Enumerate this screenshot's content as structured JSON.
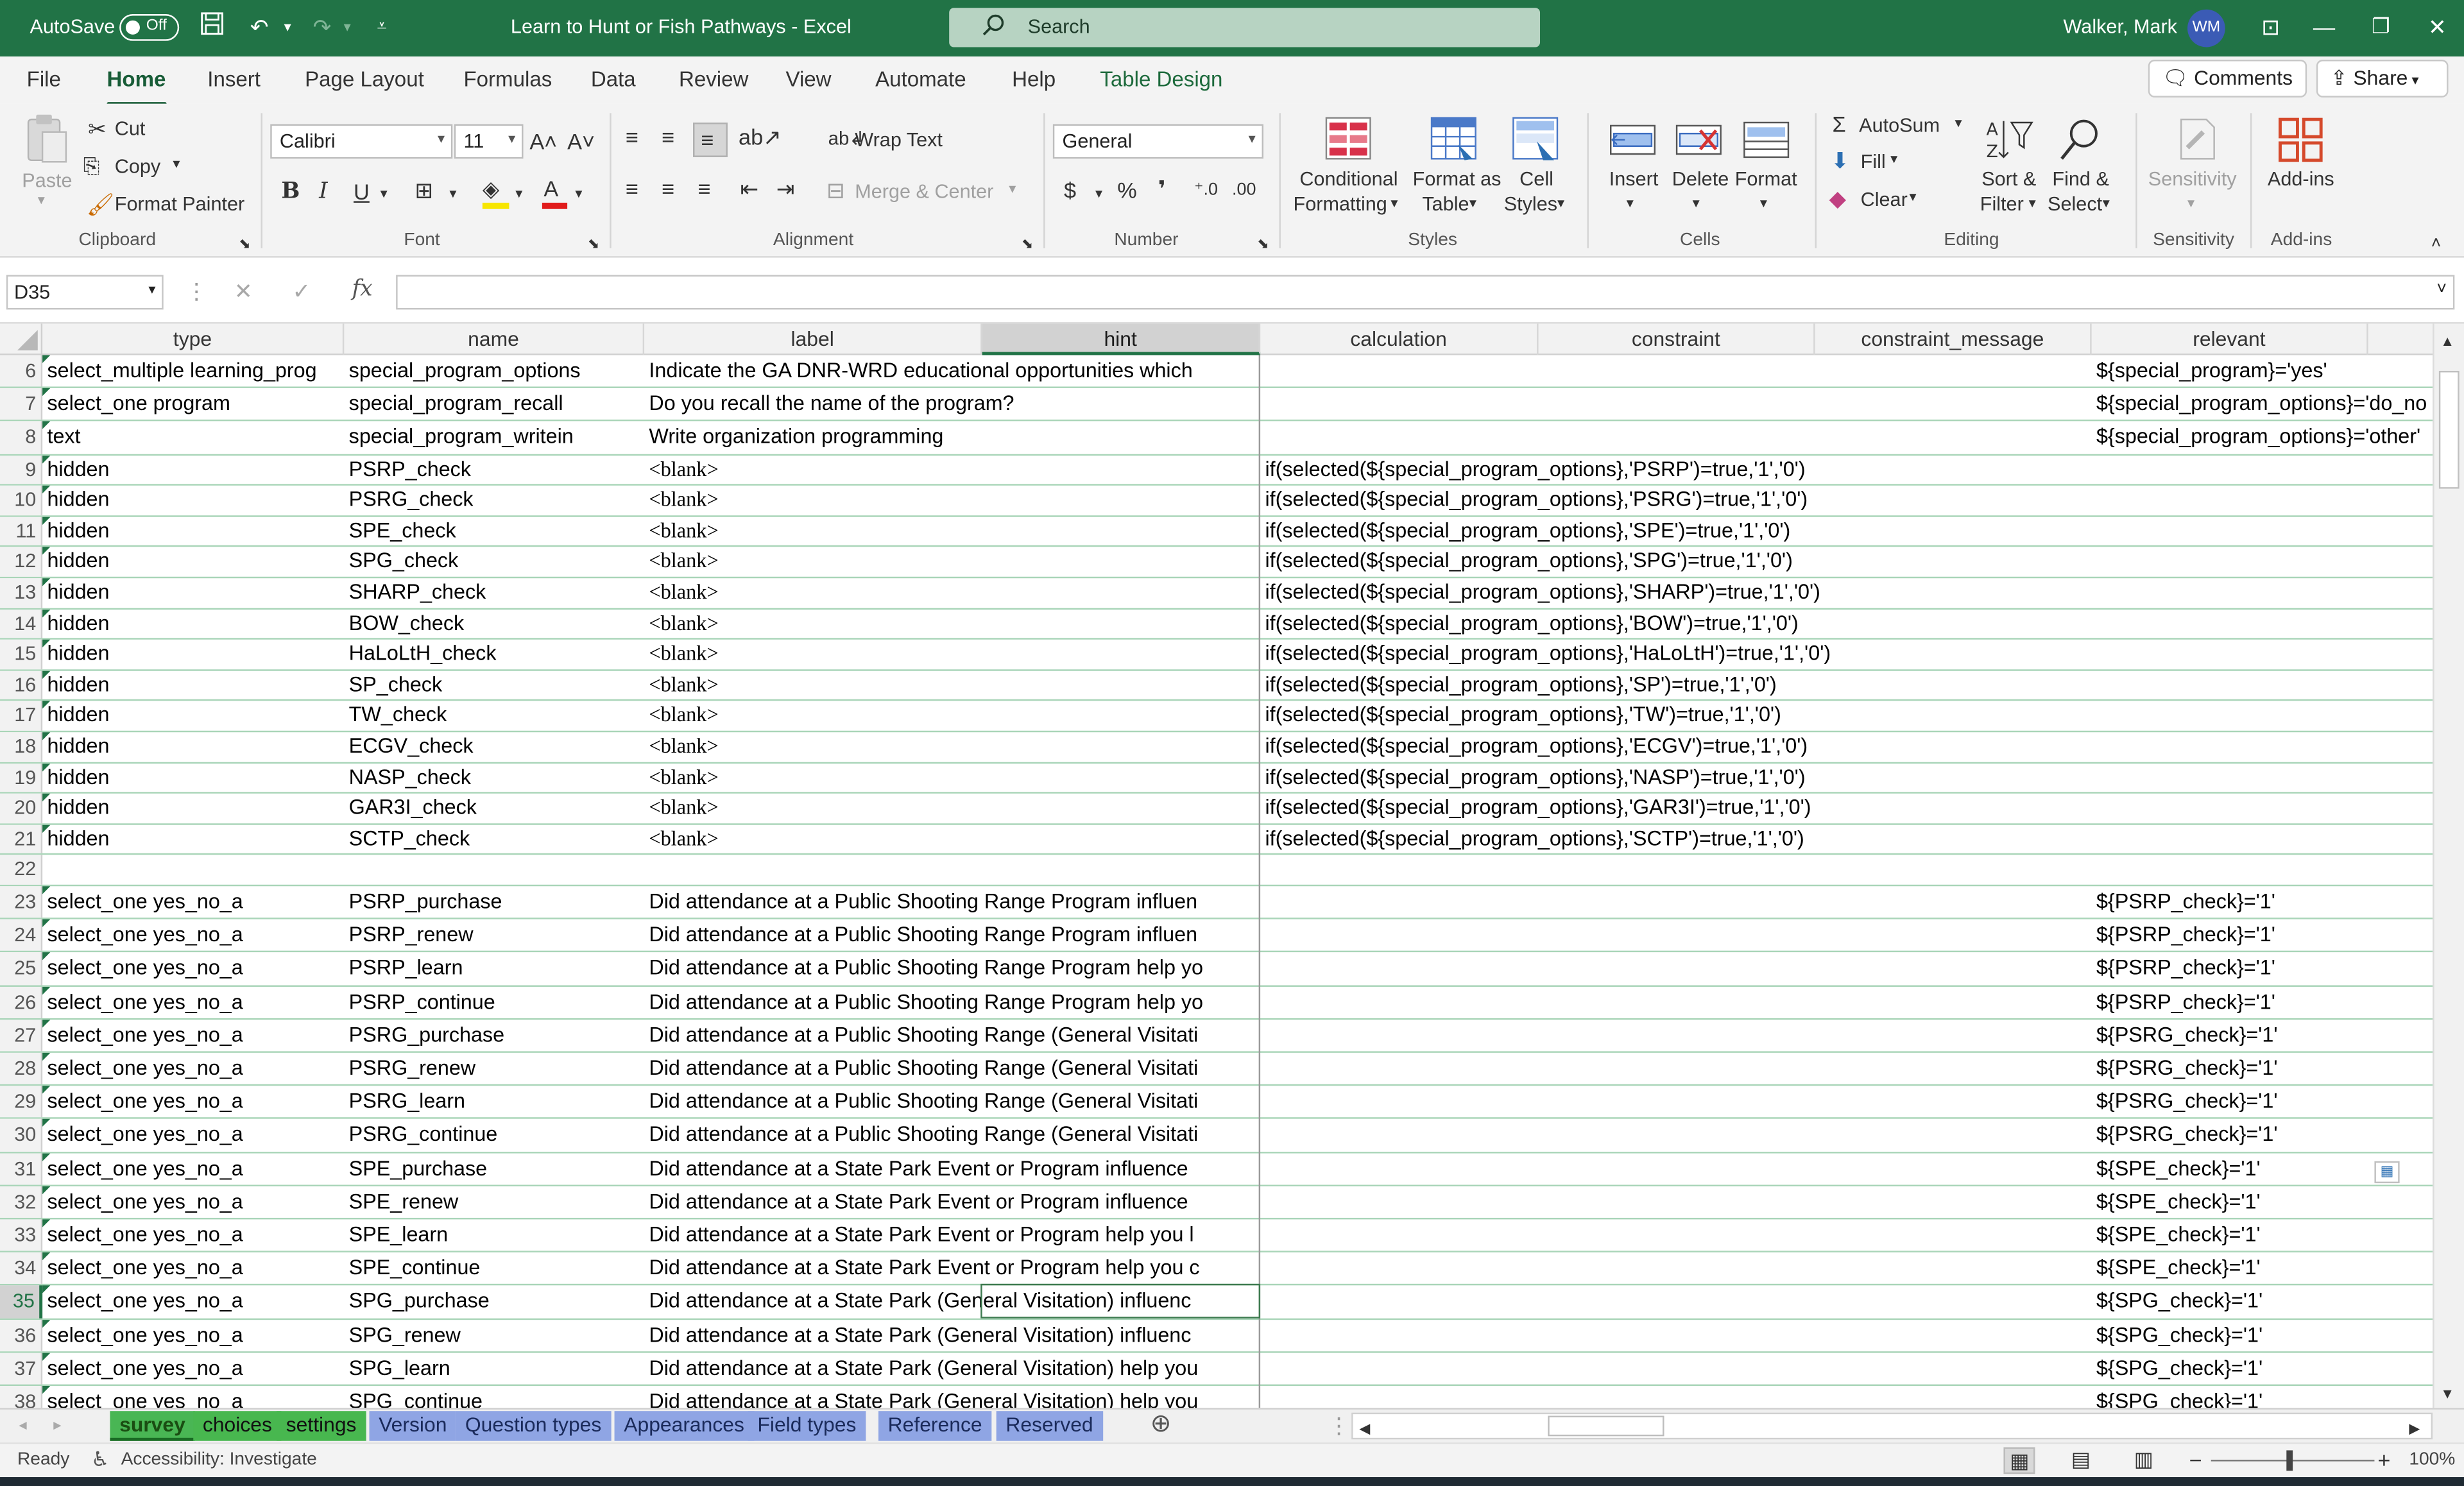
{
  "titlebar": {
    "autosave_label": "AutoSave",
    "autosave_state": "Off",
    "doc_title": "Learn to Hunt or Fish Pathways  -  Excel",
    "search_placeholder": "Search",
    "user_name": "Walker, Mark",
    "user_initials": "WM",
    "brand_color": "#217346"
  },
  "menu": {
    "tabs": [
      "File",
      "Home",
      "Insert",
      "Page Layout",
      "Formulas",
      "Data",
      "Review",
      "View",
      "Automate",
      "Help",
      "Table Design"
    ],
    "active_tab": "Home",
    "comments_label": "Comments",
    "share_label": "Share"
  },
  "ribbon": {
    "clipboard": {
      "paste": "Paste",
      "cut": "Cut",
      "copy": "Copy",
      "format_painter": "Format Painter",
      "label": "Clipboard"
    },
    "font": {
      "name": "Calibri",
      "size": "11",
      "label": "Font"
    },
    "alignment": {
      "wrap_text": "Wrap Text",
      "merge_center": "Merge & Center",
      "label": "Alignment"
    },
    "number": {
      "format": "General",
      "label": "Number"
    },
    "styles": {
      "conditional_1": "Conditional",
      "conditional_2": "Formatting",
      "format_table_1": "Format as",
      "format_table_2": "Table",
      "cell_styles_1": "Cell",
      "cell_styles_2": "Styles",
      "label": "Styles"
    },
    "cells": {
      "insert": "Insert",
      "delete": "Delete",
      "format": "Format",
      "label": "Cells"
    },
    "editing": {
      "autosum": "AutoSum",
      "fill": "Fill",
      "clear": "Clear",
      "sort_1": "Sort &",
      "sort_2": "Filter",
      "find_1": "Find &",
      "find_2": "Select",
      "label": "Editing"
    },
    "sensitivity": {
      "button": "Sensitivity",
      "label": "Sensitivity"
    },
    "addins": {
      "button": "Add-ins",
      "label": "Add-ins"
    }
  },
  "formula_bar": {
    "name_box": "D35",
    "fx": "fx",
    "content": ""
  },
  "columns": [
    "type",
    "name",
    "label",
    "hint",
    "calculation",
    "constraint",
    "constraint_message",
    "relevant"
  ],
  "selected_column": "hint",
  "rows": [
    {
      "n": "6",
      "type": "select_multiple learning_prog",
      "name": "special_program_options",
      "label": "Indicate the GA DNR-WRD educational opportunities which",
      "calculation": "",
      "relevant": "${special_program}='yes'"
    },
    {
      "n": "7",
      "type": "select_one program",
      "name": "special_program_recall",
      "label": "Do you recall the name of the program?",
      "calculation": "",
      "relevant": "${special_program_options}='do_no"
    },
    {
      "n": "8",
      "type": "text",
      "name": "special_program_writein",
      "label": "Write organization programming",
      "calculation": "",
      "relevant": "${special_program_options}='other'"
    },
    {
      "n": "9",
      "type": "hidden",
      "name": "PSRP_check",
      "label": "<blank>",
      "calculation": "if(selected(${special_program_options},'PSRP')=true,'1','0')",
      "relevant": ""
    },
    {
      "n": "10",
      "type": "hidden",
      "name": "PSRG_check",
      "label": "<blank>",
      "calculation": "if(selected(${special_program_options},'PSRG')=true,'1','0')",
      "relevant": ""
    },
    {
      "n": "11",
      "type": "hidden",
      "name": "SPE_check",
      "label": "<blank>",
      "calculation": "if(selected(${special_program_options},'SPE')=true,'1','0')",
      "relevant": ""
    },
    {
      "n": "12",
      "type": "hidden",
      "name": "SPG_check",
      "label": "<blank>",
      "calculation": "if(selected(${special_program_options},'SPG')=true,'1','0')",
      "relevant": ""
    },
    {
      "n": "13",
      "type": "hidden",
      "name": "SHARP_check",
      "label": "<blank>",
      "calculation": "if(selected(${special_program_options},'SHARP')=true,'1','0')",
      "relevant": ""
    },
    {
      "n": "14",
      "type": "hidden",
      "name": "BOW_check",
      "label": "<blank>",
      "calculation": "if(selected(${special_program_options},'BOW')=true,'1','0')",
      "relevant": ""
    },
    {
      "n": "15",
      "type": "hidden",
      "name": "HaLoLtH_check",
      "label": "<blank>",
      "calculation": "if(selected(${special_program_options},'HaLoLtH')=true,'1','0')",
      "relevant": ""
    },
    {
      "n": "16",
      "type": "hidden",
      "name": "SP_check",
      "label": "<blank>",
      "calculation": "if(selected(${special_program_options},'SP')=true,'1','0')",
      "relevant": ""
    },
    {
      "n": "17",
      "type": "hidden",
      "name": "TW_check",
      "label": "<blank>",
      "calculation": "if(selected(${special_program_options},'TW')=true,'1','0')",
      "relevant": ""
    },
    {
      "n": "18",
      "type": "hidden",
      "name": "ECGV_check",
      "label": "<blank>",
      "calculation": "if(selected(${special_program_options},'ECGV')=true,'1','0')",
      "relevant": ""
    },
    {
      "n": "19",
      "type": "hidden",
      "name": "NASP_check",
      "label": "<blank>",
      "calculation": "if(selected(${special_program_options},'NASP')=true,'1','0')",
      "relevant": ""
    },
    {
      "n": "20",
      "type": "hidden",
      "name": "GAR3I_check",
      "label": "<blank>",
      "calculation": "if(selected(${special_program_options},'GAR3I')=true,'1','0')",
      "relevant": ""
    },
    {
      "n": "21",
      "type": "hidden",
      "name": "SCTP_check",
      "label": "<blank>",
      "calculation": "if(selected(${special_program_options},'SCTP')=true,'1','0')",
      "relevant": ""
    },
    {
      "n": "22",
      "type": "",
      "name": "",
      "label": "",
      "calculation": "",
      "relevant": ""
    },
    {
      "n": "23",
      "type": "select_one yes_no_a",
      "name": "PSRP_purchase",
      "label": "Did attendance at a Public Shooting Range Program influen",
      "calculation": "",
      "relevant": "${PSRP_check}='1'"
    },
    {
      "n": "24",
      "type": "select_one yes_no_a",
      "name": "PSRP_renew",
      "label": "Did attendance at a Public Shooting Range Program influen",
      "calculation": "",
      "relevant": "${PSRP_check}='1'"
    },
    {
      "n": "25",
      "type": "select_one yes_no_a",
      "name": "PSRP_learn",
      "label": "Did attendance at a Public Shooting Range Program help yo",
      "calculation": "",
      "relevant": "${PSRP_check}='1'"
    },
    {
      "n": "26",
      "type": "select_one yes_no_a",
      "name": "PSRP_continue",
      "label": "Did attendance at a Public Shooting Range Program help yo",
      "calculation": "",
      "relevant": "${PSRP_check}='1'"
    },
    {
      "n": "27",
      "type": "select_one yes_no_a",
      "name": "PSRG_purchase",
      "label": "Did attendance at a Public Shooting Range (General Visitati",
      "calculation": "",
      "relevant": "${PSRG_check}='1'"
    },
    {
      "n": "28",
      "type": "select_one yes_no_a",
      "name": "PSRG_renew",
      "label": "Did attendance at a Public Shooting Range (General Visitati",
      "calculation": "",
      "relevant": "${PSRG_check}='1'"
    },
    {
      "n": "29",
      "type": "select_one yes_no_a",
      "name": "PSRG_learn",
      "label": "Did attendance at a Public Shooting Range (General Visitati",
      "calculation": "",
      "relevant": "${PSRG_check}='1'"
    },
    {
      "n": "30",
      "type": "select_one yes_no_a",
      "name": "PSRG_continue",
      "label": "Did attendance at a Public Shooting Range (General Visitati",
      "calculation": "",
      "relevant": "${PSRG_check}='1'"
    },
    {
      "n": "31",
      "type": "select_one yes_no_a",
      "name": "SPE_purchase",
      "label": "Did attendance at a State Park Event or Program influence",
      "calculation": "",
      "relevant": "${SPE_check}='1'"
    },
    {
      "n": "32",
      "type": "select_one yes_no_a",
      "name": "SPE_renew",
      "label": "Did attendance at a State Park Event or Program influence",
      "calculation": "",
      "relevant": "${SPE_check}='1'"
    },
    {
      "n": "33",
      "type": "select_one yes_no_a",
      "name": "SPE_learn",
      "label": "Did attendance at a State Park Event or Program help you l",
      "calculation": "",
      "relevant": "${SPE_check}='1'"
    },
    {
      "n": "34",
      "type": "select_one yes_no_a",
      "name": "SPE_continue",
      "label": "Did attendance at a State Park Event or Program help you c",
      "calculation": "",
      "relevant": "${SPE_check}='1'"
    },
    {
      "n": "35",
      "type": "select_one yes_no_a",
      "name": "SPG_purchase",
      "label": "Did attendance at a State Park (General Visitation) influenc",
      "calculation": "",
      "relevant": "${SPG_check}='1'"
    },
    {
      "n": "36",
      "type": "select_one yes_no_a",
      "name": "SPG_renew",
      "label": "Did attendance at a State Park (General Visitation) influenc",
      "calculation": "",
      "relevant": "${SPG_check}='1'"
    },
    {
      "n": "37",
      "type": "select_one yes_no_a",
      "name": "SPG_learn",
      "label": "Did attendance at a State Park (General Visitation) help you",
      "calculation": "",
      "relevant": "${SPG_check}='1'"
    },
    {
      "n": "38",
      "type": "select_one yes_no_a",
      "name": "SPG_continue",
      "label": "Did attendance at a State Park (General Visitation) help you",
      "calculation": "",
      "relevant": "${SPG_check}='1'"
    }
  ],
  "selected_row": "35",
  "sheet_tabs": [
    {
      "label": "survey",
      "color": "green",
      "active": true
    },
    {
      "label": "choices",
      "color": "green",
      "active": false
    },
    {
      "label": "settings",
      "color": "green",
      "active": false
    },
    {
      "label": "Version",
      "color": "blue",
      "active": false
    },
    {
      "label": "Question types",
      "color": "blue",
      "active": false
    },
    {
      "label": "Appearances",
      "color": "blue",
      "active": false
    },
    {
      "label": "Field types",
      "color": "blue",
      "active": false
    },
    {
      "label": "Reference",
      "color": "blue",
      "active": false
    },
    {
      "label": "Reserved",
      "color": "blue",
      "active": false
    }
  ],
  "status": {
    "ready": "Ready",
    "accessibility": "Accessibility: Investigate",
    "zoom": "100%"
  }
}
